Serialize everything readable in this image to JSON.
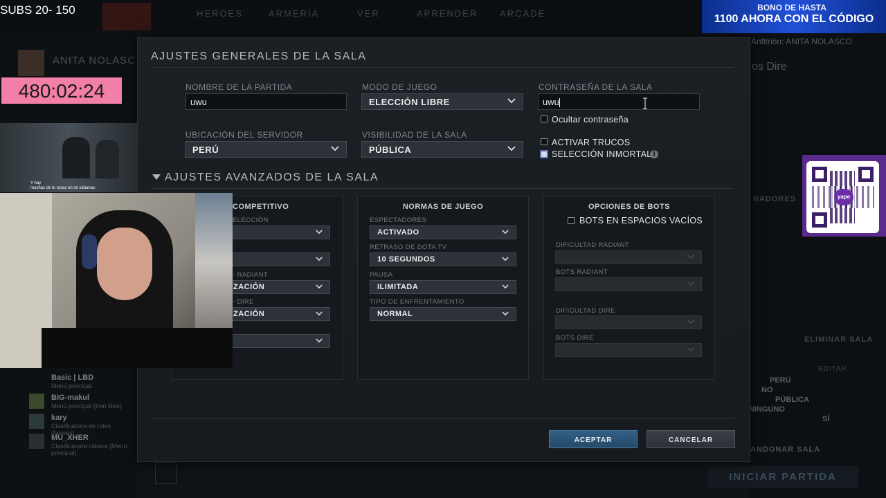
{
  "overlay": {
    "subs_text": "SUBS 20- 150",
    "timer": "480:02:24",
    "promo_line1": "BONO DE HASTA",
    "promo_line2": "1100 AHORA CON EL CÓDIGO",
    "qr_label": "yape",
    "video_caption_line1": "Y hay",
    "video_caption_line2": "muchas de tu rosas en mi sábanas."
  },
  "background": {
    "nav": [
      "HEROES",
      "ARMERÍA",
      "VER",
      "APRENDER",
      "ARCADE"
    ],
    "profile_name": "ANITA NOLASC...",
    "host_label": "Anfitrión: ANITA NOLASCO",
    "team_label": "os Dire",
    "right_labels": [
      "NADORES",
      "ELIMINAR SALA",
      "EDITAR"
    ],
    "summary_values": [
      "PERÚ",
      "NO",
      "PÚBLICA",
      "NINGUNO",
      "SÍ"
    ],
    "leave_button": "ANDONAR SALA",
    "start_button": "INICIAR PARTIDA",
    "friends": [
      {
        "name": "Basic | LBD",
        "status": "Menú principal"
      },
      {
        "name": "BIG-makul",
        "status": "Menú principal (tren libre)"
      },
      {
        "name": "kary",
        "status": "Clasificatoria de roles (heroes)"
      },
      {
        "name": "MU_XHER",
        "status": "Clasificatoria clásica (Menú principal)"
      }
    ]
  },
  "modal": {
    "title": "AJUSTES GENERALES DE LA SALA",
    "game_name_label": "NOMBRE DE LA PARTIDA",
    "game_name_value": "uwu",
    "game_mode_label": "MODO DE JUEGO",
    "game_mode_value": "ELECCIÓN LIBRE",
    "password_label": "CONTRASEÑA DE LA SALA",
    "password_value": "uwu",
    "hide_password_label": "Ocultar contraseña",
    "server_label": "UBICACIÓN DEL SERVIDOR",
    "server_value": "PERÚ",
    "visibility_label": "VISIBILIDAD DE LA SALA",
    "visibility_value": "PÚBLICA",
    "cheats_label": "ACTIVAR TRUCOS",
    "immortal_label": "SELECCIÓN INMORTAL",
    "advanced_title": "AJUSTES AVANZADOS DE LA SALA",
    "competitive": {
      "title": "COMPETITIVO",
      "labels": [
        "ELECCIÓN",
        "",
        "- RADIANT",
        "- DIRE",
        ""
      ],
      "values": [
        "",
        "",
        "ZACIÓN",
        "ZACIÓN",
        ""
      ]
    },
    "rules": {
      "title": "NORMAS DE JUEGO",
      "spectators_label": "ESPECTADORES",
      "spectators_value": "ACTIVADO",
      "delay_label": "RETRASO DE DOTA TV",
      "delay_value": "10 SEGUNDOS",
      "pause_label": "PAUSA",
      "pause_value": "ILIMITADA",
      "matchup_label": "TIPO DE ENFRENTAMIENTO",
      "matchup_value": "NORMAL"
    },
    "bots": {
      "title": "OPCIONES DE BOTS",
      "fill_label": "BOTS EN ESPACIOS VACÍOS",
      "radiant_difficulty": "DIFICULTAD RADIANT",
      "radiant_bots": "BOTS RADIANT",
      "dire_difficulty": "DIFICULTAD DIRE",
      "dire_bots": "BOTS DIRE"
    },
    "accept": "ACEPTAR",
    "cancel": "CANCELAR"
  },
  "colors": {
    "accent_blue": "#2e5d86",
    "timer_pink": "#f27fa8",
    "yape_purple": "#5a2a8c"
  }
}
